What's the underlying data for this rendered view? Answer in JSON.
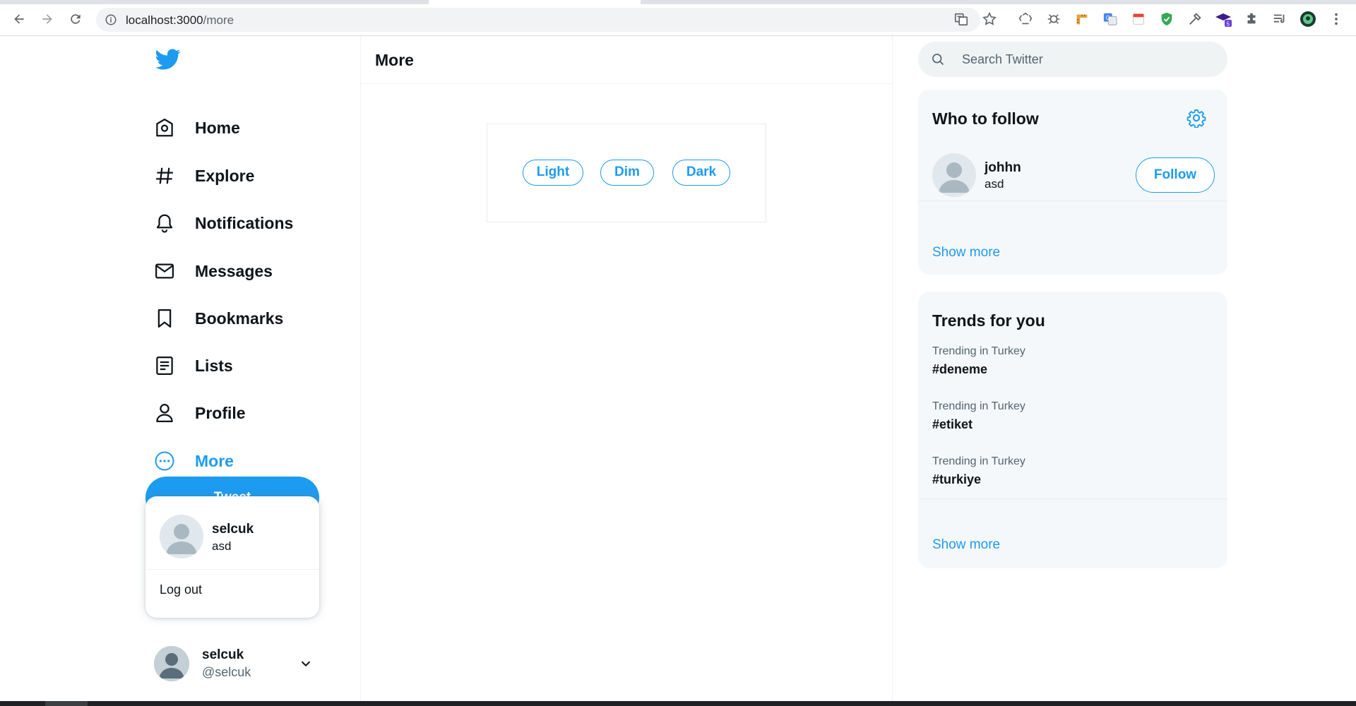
{
  "browser": {
    "url_host": "localhost:3000",
    "url_path": "/more"
  },
  "sidebar": {
    "items": [
      {
        "label": "Home",
        "icon": "home-icon"
      },
      {
        "label": "Explore",
        "icon": "hashtag-icon"
      },
      {
        "label": "Notifications",
        "icon": "bell-icon"
      },
      {
        "label": "Messages",
        "icon": "envelope-icon"
      },
      {
        "label": "Bookmarks",
        "icon": "bookmark-icon"
      },
      {
        "label": "Lists",
        "icon": "list-icon"
      },
      {
        "label": "Profile",
        "icon": "person-icon"
      },
      {
        "label": "More",
        "icon": "more-circle-icon",
        "active": true
      }
    ],
    "tweet_label": "Tweet",
    "popup": {
      "name": "selcuk",
      "handle": "asd",
      "logout": "Log out"
    },
    "account": {
      "name": "selcuk",
      "handle": "@selcuk"
    }
  },
  "main": {
    "title": "More",
    "themes": [
      "Light",
      "Dim",
      "Dark"
    ]
  },
  "right": {
    "search_placeholder": "Search Twitter",
    "who_to_follow": {
      "title": "Who to follow",
      "users": [
        {
          "name": "johhn",
          "handle": "asd",
          "button": "Follow"
        }
      ],
      "show_more": "Show more"
    },
    "trends": {
      "title": "Trends for you",
      "items": [
        {
          "context": "Trending in Turkey",
          "tag": "#deneme"
        },
        {
          "context": "Trending in Turkey",
          "tag": "#etiket"
        },
        {
          "context": "Trending in Turkey",
          "tag": "#turkiye"
        }
      ],
      "show_more": "Show more"
    }
  },
  "colors": {
    "accent": "#1d9bf0",
    "text": "#0f1419",
    "muted": "#536471",
    "panel": "#f5f8fa"
  }
}
